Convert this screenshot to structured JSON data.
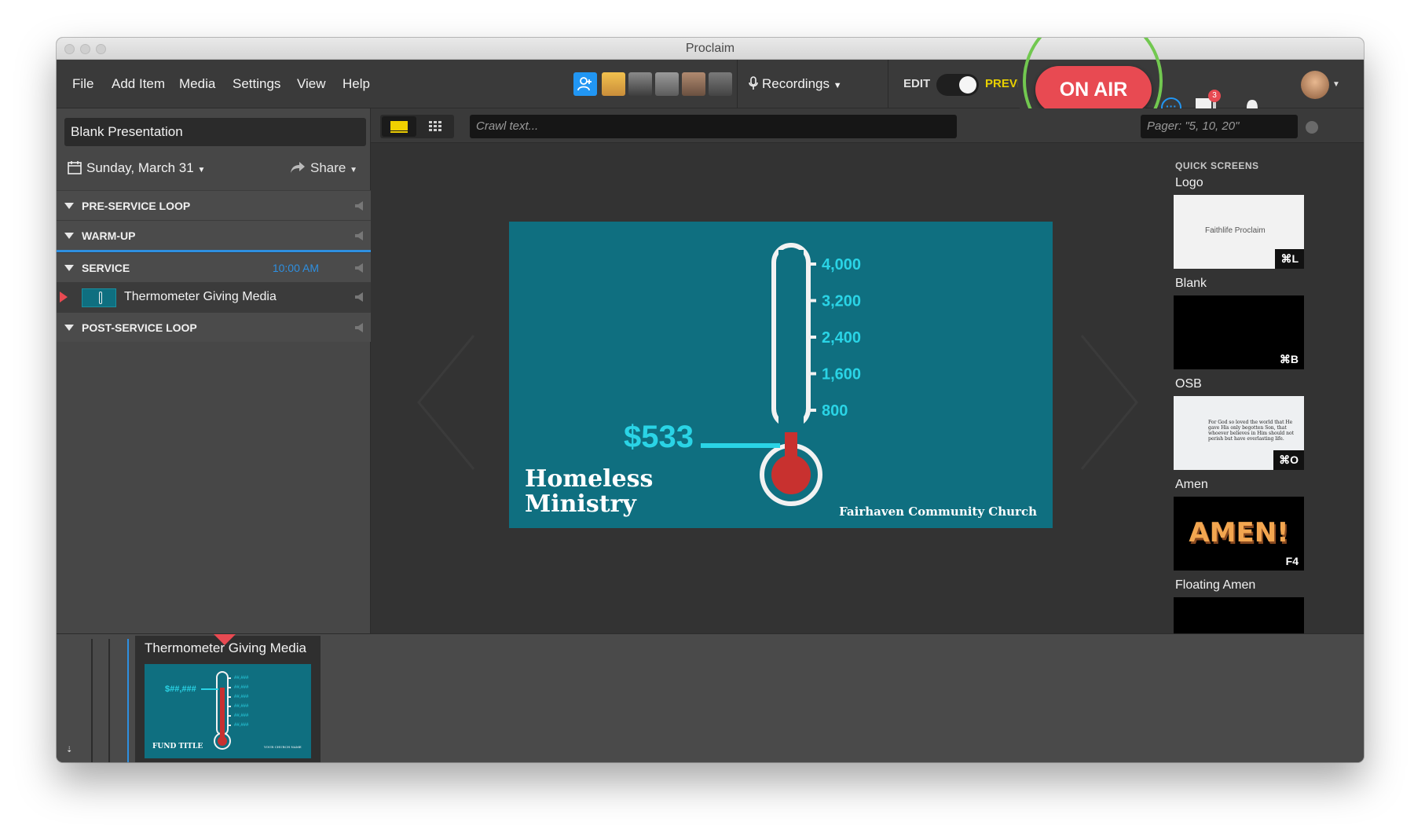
{
  "window": {
    "title": "Proclaim"
  },
  "menu": {
    "items": [
      "File",
      "Add Item",
      "Media",
      "Settings",
      "View",
      "Help"
    ],
    "recordings_label": "Recordings",
    "edit_label": "EDIT",
    "preview_label": "PREVIEW",
    "on_air_label": "ON AIR",
    "notification_count": "3"
  },
  "sidebar": {
    "presentation_title": "Blank Presentation",
    "date": "Sunday, March 31",
    "share_label": "Share",
    "sections": [
      {
        "label": "PRE-SERVICE LOOP"
      },
      {
        "label": "WARM-UP"
      },
      {
        "label": "SERVICE",
        "time": "10:00 AM"
      },
      {
        "label": "POST-SERVICE LOOP"
      }
    ],
    "service_item": "Thermometer Giving Media"
  },
  "toolbar": {
    "crawl_placeholder": "Crawl text...",
    "pager_placeholder": "Pager: \"5, 10, 20\""
  },
  "slide": {
    "amount": "$533",
    "ticks": [
      "4,000",
      "3,200",
      "2,400",
      "1,600",
      "800"
    ],
    "fund_line1": "Homeless",
    "fund_line2": "Ministry",
    "church": "Fairhaven Community Church",
    "progress": 0.13
  },
  "quick_screens": {
    "heading": "QUICK SCREENS",
    "items": [
      {
        "label": "Logo",
        "shortcut": "⌘L",
        "logo_text": "Faithlife Proclaim"
      },
      {
        "label": "Blank",
        "shortcut": "⌘B"
      },
      {
        "label": "OSB",
        "shortcut": "⌘O",
        "verse": "For God so loved the world that He gave His only begotten Son, that whoever believes in Him should not perish but have everlasting life."
      },
      {
        "label": "Amen",
        "shortcut": "F4",
        "word": "AMEN!"
      },
      {
        "label": "Floating Amen"
      }
    ]
  },
  "timeline": {
    "card_title": "Thermometer Giving Media",
    "thumb_amount": "$##,###",
    "thumb_tick": "##,###",
    "thumb_fund": "FUND TITLE",
    "thumb_church": "YOUR CHURCH NAME"
  },
  "colors": {
    "accent": "#2196f3",
    "on_air": "#e84a52",
    "highlight_ring": "#72c850",
    "slide_bg": "#0f6f80",
    "thermo_red": "#c8312f",
    "slide_cyan": "#2ad4e6"
  }
}
